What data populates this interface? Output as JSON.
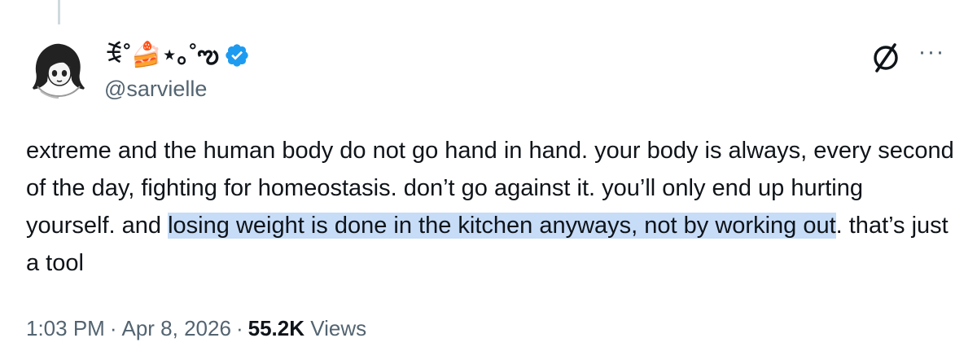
{
  "author": {
    "display_name": "ꉂ˚🍰⋆｡˚ఌ",
    "handle": "@sarvielle",
    "verified": true,
    "avatar_icon": "anime-girl-avatar"
  },
  "actions": {
    "grok_icon": "grok-icon",
    "more_label": "···"
  },
  "tweet": {
    "text_before": "extreme and the human body do not go hand in hand. your body is always, every second of the day, fighting for homeostasis. don’t go against it. you’ll only end up hurting yourself. and ",
    "text_highlighted": "losing weight is done in the kitchen anyways, not by working out",
    "text_after": ". that’s just a tool"
  },
  "meta": {
    "time": "1:03 PM",
    "separator": "·",
    "date": "Apr 8, 2026",
    "views_count": "55.2K",
    "views_label": "Views"
  },
  "colors": {
    "text": "#0f1419",
    "secondary": "#536471",
    "verified": "#1d9bf0",
    "highlight": "#c6dcf7"
  }
}
